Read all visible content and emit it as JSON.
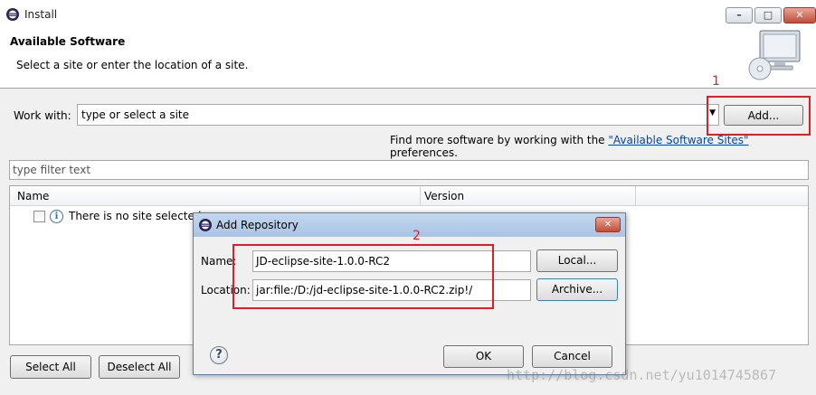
{
  "window": {
    "title": "Install"
  },
  "header": {
    "title": "Available Software",
    "subtitle": "Select a site or enter the location of a site."
  },
  "work_with": {
    "label": "Work with:",
    "value": "type or select a site",
    "add_label": "Add...",
    "annotation": "1"
  },
  "find_more": {
    "prefix": "Find more software by working with the ",
    "link": "\"Available Software Sites\"",
    "suffix": " preferences."
  },
  "filter": {
    "placeholder": "type filter text"
  },
  "table": {
    "columns": [
      "Name",
      "Version"
    ],
    "rows": [
      {
        "name": "There is no site selected."
      }
    ]
  },
  "buttons": {
    "select_all": "Select All",
    "deselect_all": "Deselect All"
  },
  "dialog": {
    "title": "Add Repository",
    "name_label": "Name:",
    "name_value": "JD-eclipse-site-1.0.0-RC2",
    "location_label": "Location:",
    "location_value": "jar:file:/D:/jd-eclipse-site-1.0.0-RC2.zip!/",
    "local_label": "Local...",
    "archive_label": "Archive...",
    "ok_label": "OK",
    "cancel_label": "Cancel",
    "annotation": "2"
  },
  "watermark": "http://blog.csdn.net/yu1014745867",
  "colors": {
    "annotation_red": "#e02020",
    "link_blue": "#0645ad"
  },
  "icons": [
    "eclipse-icon",
    "minimize-icon",
    "maximize-icon",
    "close-icon",
    "monitor-cd-icon",
    "dropdown-arrow-icon",
    "info-icon",
    "help-icon"
  ]
}
